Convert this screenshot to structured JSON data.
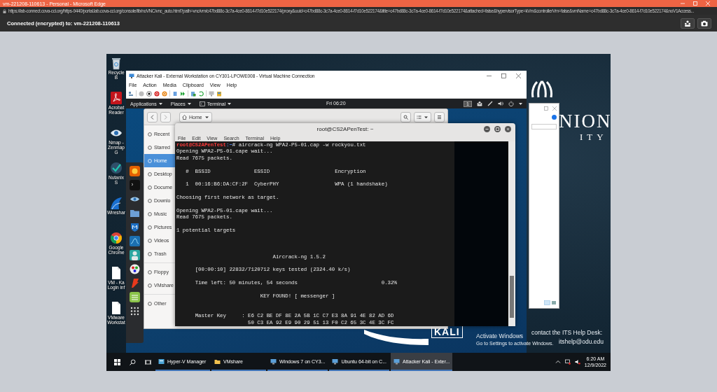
{
  "browser": {
    "title": "vm-221208-110613 - Personal - Microsoft Edge",
    "url": "https://lab-connect.cova-cci.org/https-9440/portal.lab.cova-cci.org/console/lib/noVNC/vnc_auto.html?path=vnc/vm/c47bd88c-3c7a-4ce0-8614-f7d10e522174/proxy&uuid=c47bd88c-3c7a-4ce0-8614-f7d10e522174&title=c47bd88c-3c7a-4ce0-8614-f7d10e522174&attached=false&hypervisorType=kVm&controllerVm=false&vmName=c47bd88c-3c7a-4ce0-8614-f7d10e522174&noV1Access...",
    "vnc_status": "Connected (encrypted) to: vm-221208-110613"
  },
  "remote_desktop": {
    "desktop_icons": [
      {
        "label": "Recycle B",
        "kind": "bin"
      },
      {
        "label": "Acrobat Reader",
        "kind": "pdf"
      },
      {
        "label": "Nmap - Zenmap G",
        "kind": "eye"
      },
      {
        "label": "Nutanix S",
        "kind": "check"
      },
      {
        "label": "Wireshar",
        "kind": "fin"
      },
      {
        "label": "Google Chrome",
        "kind": "ring"
      },
      {
        "label": "VM - Ka Login inf",
        "kind": "doc"
      },
      {
        "label": "VMware Workstat",
        "kind": "doc"
      }
    ],
    "wallpaper": {
      "logo_lines": [
        "NION",
        "ITY"
      ],
      "help_lines": [
        "contact the ITS Help Desk:",
        "itshelp@odu.edu"
      ]
    },
    "activation_notice": {
      "title": "Activate Windows",
      "text": "Go to Settings to activate Windows."
    },
    "vm_window": {
      "title": "Attacker Kali - External Workstation on CY301-LPOWE008 - Virtual Machine Connection",
      "menu": [
        "File",
        "Action",
        "Media",
        "Clipboard",
        "View",
        "Help"
      ],
      "guest": {
        "top_bar": {
          "menus": [
            {
              "label": "Applications",
              "icon": false
            },
            {
              "label": "Places",
              "icon": false
            },
            {
              "label": "Terminal",
              "icon": true
            }
          ],
          "clock": "Fri 06:20",
          "workspace": "1"
        },
        "files": {
          "location": "Home",
          "sidebar": [
            {
              "label": "Recent",
              "selected": false
            },
            {
              "label": "Starred",
              "selected": false
            },
            {
              "label": "Home",
              "selected": true
            },
            {
              "label": "Desktop",
              "selected": false
            },
            {
              "label": "Docume",
              "selected": false
            },
            {
              "label": "Downlo",
              "selected": false
            },
            {
              "label": "Music",
              "selected": false
            },
            {
              "label": "Pictures",
              "selected": false
            },
            {
              "label": "Videos",
              "selected": false
            },
            {
              "label": "Trash",
              "selected": false
            },
            {
              "label": "Floppy",
              "selected": false
            },
            {
              "label": "VMshare",
              "selected": false
            },
            {
              "label": "Other",
              "selected": false
            }
          ]
        },
        "terminal": {
          "title": "root@CS2APenTest: ~",
          "menu": [
            "File",
            "Edit",
            "View",
            "Search",
            "Terminal",
            "Help"
          ],
          "prompt": {
            "user": "root@CS2APenTest",
            "path": ":~",
            "command": "# aircrack-ng WPA2-P5-01.cap -w rockyou.txt"
          },
          "lines": [
            {
              "kind": "text",
              "text": "Opening WPA2-P5-01.cape wait..."
            },
            {
              "kind": "text",
              "text": "Read 7675 packets."
            },
            {
              "kind": "blank"
            },
            {
              "kind": "text",
              "text": "   #  BSSID              ESSID                     Encryption"
            },
            {
              "kind": "blank"
            },
            {
              "kind": "text",
              "text": "   1  00:16:B6:DA:CF:2F  CyberPHY                  WPA (1 handshake)"
            },
            {
              "kind": "blank"
            },
            {
              "kind": "text",
              "text": "Choosing first network as target."
            },
            {
              "kind": "blank"
            },
            {
              "kind": "text",
              "text": "Opening WPA2-P5-01.cape wait..."
            },
            {
              "kind": "text",
              "text": "Read 7675 packets."
            },
            {
              "kind": "blank"
            },
            {
              "kind": "text",
              "text": "1 potential targets"
            },
            {
              "kind": "blank"
            },
            {
              "kind": "blank"
            },
            {
              "kind": "blank"
            },
            {
              "kind": "text",
              "text": "                               Aircrack-ng 1.5.2"
            },
            {
              "kind": "blank"
            },
            {
              "kind": "text",
              "text": "      [00:00:10] 22832/7120712 keys tested (2324.40 k/s)"
            },
            {
              "kind": "blank"
            },
            {
              "kind": "text",
              "text": "      Time left: 50 minutes, 54 seconds                           0.32%"
            },
            {
              "kind": "blank"
            },
            {
              "kind": "text",
              "text": "                           KEY FOUND! [ messenger ]"
            },
            {
              "kind": "blank"
            },
            {
              "kind": "blank"
            },
            {
              "kind": "text",
              "text": "      Master Key     : E6 C2 BE DF 8E 2A 5B 1C C7 E3 8A 91 4E 82 AD 6D"
            },
            {
              "kind": "text",
              "text": "                       50 C3 EA 92 E9 90 29 51 13 F0 C2 65 3C 4E 3C FC"
            }
          ]
        },
        "logo": "KALI"
      }
    },
    "taskbar": {
      "items": [
        {
          "label": "Hyper-V Manager",
          "selected": false
        },
        {
          "label": "VMshare",
          "selected": false
        },
        {
          "label": "Windows 7 on CY3...",
          "selected": false
        },
        {
          "label": "Ubuntu 64-bit on C...",
          "selected": false
        },
        {
          "label": "Attacker Kali - Exter...",
          "selected": true
        }
      ],
      "time": "6:20 AM",
      "date": "12/9/2022"
    }
  }
}
